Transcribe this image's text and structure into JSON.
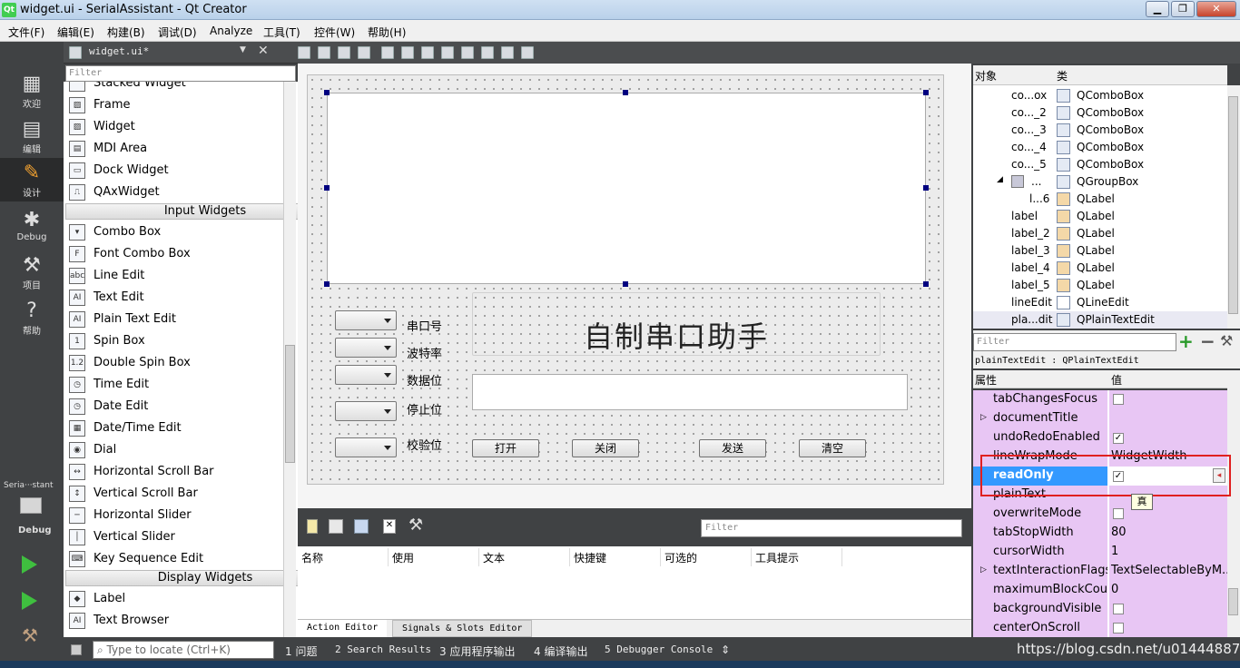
{
  "window": {
    "title": "widget.ui - SerialAssistant - Qt Creator",
    "icon": "Qt",
    "min": "▁",
    "max": "❐",
    "close": "✕"
  },
  "menu": [
    "文件(F)",
    "编辑(E)",
    "构建(B)",
    "调试(D)",
    "Analyze",
    "工具(T)",
    "控件(W)",
    "帮助(H)"
  ],
  "modes": [
    {
      "icon": "grid-icon",
      "glyph": "▦",
      "label": "欢迎"
    },
    {
      "icon": "edit-icon",
      "glyph": "▤",
      "label": "编辑"
    },
    {
      "icon": "pencil-icon",
      "glyph": "✎",
      "label": "设计"
    },
    {
      "icon": "bug-icon",
      "glyph": "✱",
      "label": "Debug"
    },
    {
      "icon": "wrench-icon",
      "glyph": "⚒",
      "label": "项目"
    },
    {
      "icon": "help-icon",
      "glyph": "?",
      "label": "帮助"
    }
  ],
  "kit": {
    "project": "Seria···stant",
    "config": "Debug"
  },
  "editor": {
    "file": "widget.ui*"
  },
  "widgetbox": {
    "filter_placeholder": "Filter",
    "items": [
      [
        "Stacked Widget",
        ""
      ],
      [
        "Frame",
        "▨"
      ],
      [
        "Widget",
        "▨"
      ],
      [
        "MDI Area",
        "▤"
      ],
      [
        "Dock Widget",
        "▭"
      ],
      [
        "QAxWidget",
        "⎍"
      ]
    ],
    "cat_input": "Input Widgets",
    "input": [
      [
        "Combo Box",
        "▾"
      ],
      [
        "Font Combo Box",
        "F"
      ],
      [
        "Line Edit",
        "abc"
      ],
      [
        "Text Edit",
        "AI"
      ],
      [
        "Plain Text Edit",
        "AI"
      ],
      [
        "Spin Box",
        "1"
      ],
      [
        "Double Spin Box",
        "1.2"
      ],
      [
        "Time Edit",
        "◷"
      ],
      [
        "Date Edit",
        "◷"
      ],
      [
        "Date/Time Edit",
        "▦"
      ],
      [
        "Dial",
        "◉"
      ],
      [
        "Horizontal Scroll Bar",
        "↔"
      ],
      [
        "Vertical Scroll Bar",
        "↕"
      ],
      [
        "Horizontal Slider",
        "─"
      ],
      [
        "Vertical Slider",
        "│"
      ],
      [
        "Key Sequence Edit",
        "⌨"
      ]
    ],
    "cat_display": "Display Widgets",
    "display": [
      [
        "Label",
        "◆"
      ],
      [
        "Text Browser",
        "AI"
      ]
    ]
  },
  "form": {
    "labels": [
      "串口号",
      "波特率",
      "数据位",
      "停止位",
      "校验位"
    ],
    "title": "自制串口助手",
    "buttons": [
      "打开",
      "关闭",
      "发送",
      "清空"
    ]
  },
  "actions": {
    "filter_placeholder": "Filter",
    "columns": [
      "名称",
      "使用",
      "文本",
      "快捷键",
      "可选的",
      "工具提示"
    ],
    "tabs": [
      "Action Editor",
      "Signals & Slots Editor"
    ]
  },
  "objects": {
    "col_object": "对象",
    "col_class": "类",
    "rows": [
      [
        "co...ox",
        "QComboBox"
      ],
      [
        "co..._2",
        "QComboBox"
      ],
      [
        "co..._3",
        "QComboBox"
      ],
      [
        "co..._4",
        "QComboBox"
      ],
      [
        "co..._5",
        "QComboBox"
      ],
      [
        "...",
        "QGroupBox"
      ],
      [
        "l...6",
        "QLabel"
      ],
      [
        "label",
        "QLabel"
      ],
      [
        "label_2",
        "QLabel"
      ],
      [
        "label_3",
        "QLabel"
      ],
      [
        "label_4",
        "QLabel"
      ],
      [
        "label_5",
        "QLabel"
      ],
      [
        "lineEdit",
        "QLineEdit"
      ],
      [
        "pla...dit",
        "QPlainTextEdit"
      ]
    ]
  },
  "properties": {
    "filter_placeholder": "Filter",
    "object": "plainTextEdit : QPlainTextEdit",
    "col_prop": "属性",
    "col_val": "值",
    "rows": [
      [
        "tabChangesFocus",
        "",
        ""
      ],
      [
        "documentTitle",
        "",
        ""
      ],
      [
        "undoRedoEnabled",
        "✓",
        ""
      ],
      [
        "lineWrapMode",
        "WidgetWidth",
        ""
      ],
      [
        "readOnly",
        "✓",
        ""
      ],
      [
        "plainText",
        "",
        ""
      ],
      [
        "overwriteMode",
        "",
        ""
      ],
      [
        "tabStopWidth",
        "80",
        ""
      ],
      [
        "cursorWidth",
        "1",
        ""
      ],
      [
        "textInteractionFlags",
        "TextSelectableByM...",
        ""
      ],
      [
        "maximumBlockCount",
        "0",
        ""
      ],
      [
        "backgroundVisible",
        "",
        ""
      ],
      [
        "centerOnScroll",
        "",
        ""
      ]
    ],
    "tooltip": "真"
  },
  "status": {
    "locate_placeholder": "Type to locate (Ctrl+K)",
    "panes": [
      "1 问题",
      "2 Search Results",
      "3 应用程序输出",
      "4 编译输出",
      "5 Debugger Console"
    ]
  },
  "watermark": "https://blog.csdn.net/u014448875"
}
